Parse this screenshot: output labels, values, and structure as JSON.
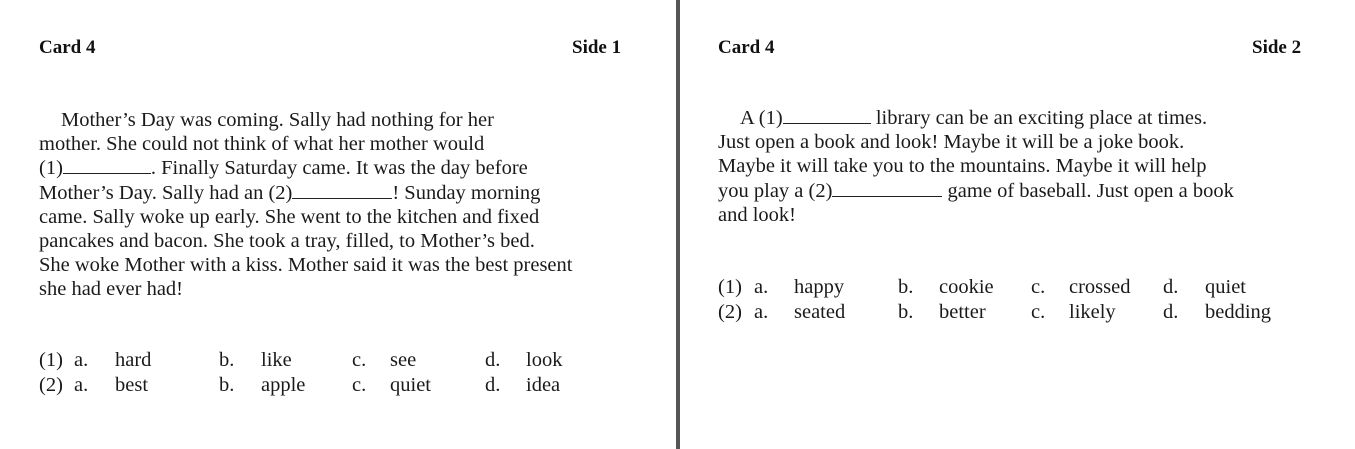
{
  "left_card": {
    "card_label": "Card 4",
    "side_label": "Side 1",
    "passage": {
      "l1": "Mother’s Day was coming. Sally had nothing for her",
      "l2": "mother. She could not think of what her mother would",
      "l3_num": "(1)",
      "l3_rest": ". Finally Saturday came. It was the day before",
      "l4_start": "Mother’s Day. Sally had an (2)",
      "l4_end": "! Sunday morning",
      "l5": "came. Sally woke up early. She went to the kitchen and fixed",
      "l6": "pancakes and bacon. She took a tray, filled, to Mother’s bed.",
      "l7": "She woke Mother with a kiss. Mother said it was the best present",
      "l8": "she had ever had!"
    },
    "options": [
      {
        "num": "(1)",
        "a": "a.",
        "a_text": "hard",
        "b": "b.",
        "b_text": "like",
        "c": "c.",
        "c_text": "see",
        "d": "d.",
        "d_text": "look"
      },
      {
        "num": "(2)",
        "a": "a.",
        "a_text": "best",
        "b": "b.",
        "b_text": "apple",
        "c": "c.",
        "c_text": "quiet",
        "d": "d.",
        "d_text": "idea"
      }
    ]
  },
  "right_card": {
    "card_label": "Card 4",
    "side_label": "Side 2",
    "passage": {
      "l1_start": "A (1)",
      "l1_end": "library can be an exciting place at times.",
      "l2": "Just open a book and look! Maybe it will be a joke book.",
      "l3": "Maybe it will take you to the mountains. Maybe it will help",
      "l4_start": "you play a (2)",
      "l4_end": "game of baseball. Just open a book",
      "l5": "and look!"
    },
    "options": [
      {
        "num": "(1)",
        "a": "a.",
        "a_text": "happy",
        "b": "b.",
        "b_text": "cookie",
        "c": "c.",
        "c_text": "crossed",
        "d": "d.",
        "d_text": "quiet"
      },
      {
        "num": "(2)",
        "a": "a.",
        "a_text": "seated",
        "b": "b.",
        "b_text": "better",
        "c": "c.",
        "c_text": "likely",
        "d": "d.",
        "d_text": "bedding"
      }
    ]
  }
}
